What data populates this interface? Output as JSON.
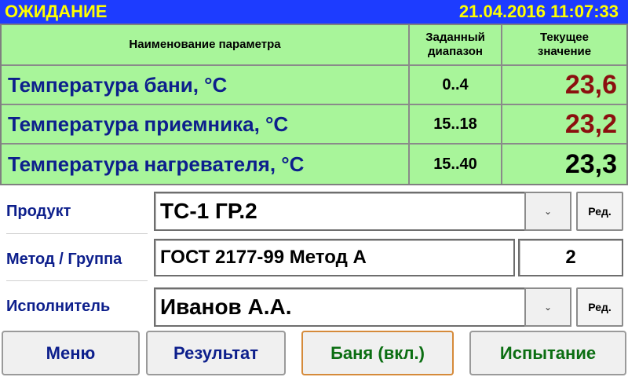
{
  "header": {
    "status": "ОЖИДАНИЕ",
    "datetime": "21.04.2016 11:07:33"
  },
  "table": {
    "col_name_header": "Наименование параметра",
    "col_range_header": [
      "Заданный",
      "диапазон"
    ],
    "col_value_header": [
      "Текущее",
      "значение"
    ],
    "rows": [
      {
        "name": "Температура бани, °С",
        "range": "0..4",
        "value": "23,6",
        "value_color": "#8b0f0f"
      },
      {
        "name": "Температура приемника, °С",
        "range": "15..18",
        "value": "23,2",
        "value_color": "#8b0f0f"
      },
      {
        "name": "Температура нагревателя, °С",
        "range": "15..40",
        "value": "23,3",
        "value_color": "#000000"
      }
    ]
  },
  "form": {
    "product": {
      "label": "Продукт",
      "value": "ТС-1 ГР.2",
      "edit_label": "Ред."
    },
    "method": {
      "label": "Метод / Группа",
      "value": "ГОСТ 2177-99 Метод А",
      "group": "2"
    },
    "executor": {
      "label": "Исполнитель",
      "value": "Иванов А.А.",
      "edit_label": "Ред."
    }
  },
  "buttons": {
    "menu": {
      "label": "Меню",
      "color": "#0d1f8c"
    },
    "result": {
      "label": "Результат",
      "color": "#0d1f8c"
    },
    "bath": {
      "label": "Баня (вкл.)",
      "color": "#0b6e12",
      "border": "#d58a3a"
    },
    "test": {
      "label": "Испытание",
      "color": "#0b6e12"
    }
  },
  "icons": {
    "dropdown": "chevron-down-icon"
  }
}
